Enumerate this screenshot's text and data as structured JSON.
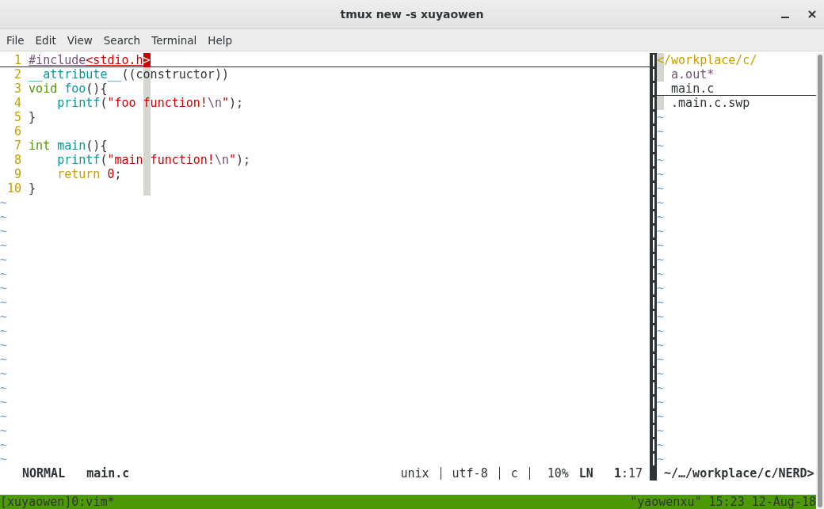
{
  "window": {
    "title": "tmux new -s xuyaowen"
  },
  "menu": [
    "File",
    "Edit",
    "View",
    "Search",
    "Terminal",
    "Help"
  ],
  "editor": {
    "color_column": true,
    "lines": [
      {
        "number": "1",
        "cursorline": true,
        "tokens": [
          {
            "kind": "preproc",
            "text": "#include"
          },
          {
            "kind": "string",
            "text": "<stdio.h"
          },
          {
            "kind": "cursor",
            "text": ">"
          }
        ]
      },
      {
        "number": "2",
        "cursorline": false,
        "tokens": [
          {
            "kind": "func",
            "text": "__attribute__"
          },
          {
            "kind": "plain",
            "text": "((constructor))"
          }
        ]
      },
      {
        "number": "3",
        "cursorline": false,
        "tokens": [
          {
            "kind": "type",
            "text": "void"
          },
          {
            "kind": "func",
            "text": " foo"
          },
          {
            "kind": "plain",
            "text": "(){"
          }
        ]
      },
      {
        "number": "4",
        "cursorline": false,
        "tokens": [
          {
            "kind": "func",
            "text": "    printf"
          },
          {
            "kind": "plain",
            "text": "("
          },
          {
            "kind": "string",
            "text": "\"foo function!"
          },
          {
            "kind": "special",
            "text": "\\n"
          },
          {
            "kind": "string",
            "text": "\""
          },
          {
            "kind": "plain",
            "text": ");"
          }
        ]
      },
      {
        "number": "5",
        "cursorline": false,
        "tokens": [
          {
            "kind": "plain",
            "text": "}"
          }
        ]
      },
      {
        "number": "6",
        "cursorline": false
      },
      {
        "number": "7",
        "cursorline": false,
        "tokens": [
          {
            "kind": "type",
            "text": "int"
          },
          {
            "kind": "func",
            "text": " main"
          },
          {
            "kind": "plain",
            "text": "(){"
          }
        ]
      },
      {
        "number": "8",
        "cursorline": false,
        "tokens": [
          {
            "kind": "func",
            "text": "    printf"
          },
          {
            "kind": "plain",
            "text": "("
          },
          {
            "kind": "string",
            "text": "\"main function!"
          },
          {
            "kind": "special",
            "text": "\\n"
          },
          {
            "kind": "string",
            "text": "\""
          },
          {
            "kind": "plain",
            "text": ");"
          }
        ]
      },
      {
        "number": "9",
        "cursorline": false,
        "tokens": [
          {
            "kind": "keyword",
            "text": "    return"
          },
          {
            "kind": "number",
            "text": " 0"
          },
          {
            "kind": "plain",
            "text": ";"
          }
        ]
      },
      {
        "number": "10",
        "cursorline": false,
        "tokens": [
          {
            "kind": "plain",
            "text": "}"
          }
        ]
      }
    ],
    "filler": [
      "~",
      "~",
      "~",
      "~",
      "~",
      "~",
      "~",
      "~",
      "~",
      "~",
      "~",
      "~",
      "~",
      "~",
      "~",
      "~",
      "~",
      "~",
      "~"
    ]
  },
  "tree": {
    "root": {
      "name": "</workplace/c/",
      "sign": true,
      "selected": false,
      "children": [
        {
          "name": "a.out*",
          "kind": "executable",
          "sign": true,
          "selected": false
        },
        {
          "name": "main.c",
          "kind": "file",
          "sign": false,
          "selected": true
        },
        {
          "name": ".main.c.swp",
          "kind": "file",
          "sign": true,
          "selected": false
        }
      ]
    },
    "filler": [
      "~",
      "~",
      "~",
      "~",
      "~",
      "~",
      "~",
      "~",
      "~",
      "~",
      "~",
      "~",
      "~",
      "~",
      "~",
      "~",
      "~",
      "~",
      "~",
      "~",
      "~",
      "~",
      "~",
      "~",
      "~"
    ]
  },
  "status_line": {
    "mode": "NORMAL",
    "file": "main.c",
    "fileformat": "unix",
    "encoding": "utf-8",
    "filetype": "c",
    "percent": "10%",
    "ln_label": "LN",
    "line": "1",
    "column": ":17",
    "tree_path": "~/…/workplace/c/NERD>"
  },
  "tmux": {
    "left": "[xuyaowen]0:vim*",
    "right": "\"yaowenxu\" 15:23 12-Aug-18"
  }
}
